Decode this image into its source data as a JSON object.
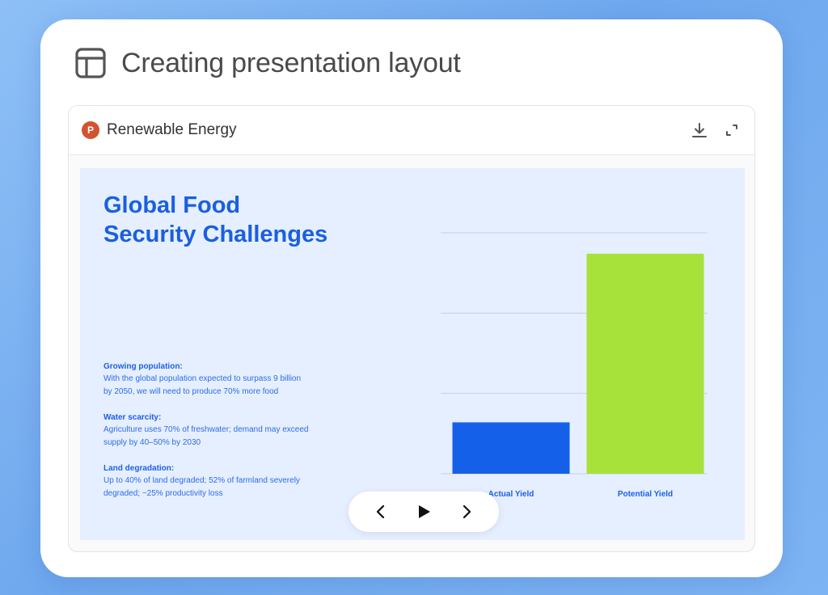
{
  "header": {
    "title": "Creating presentation layout",
    "icon": "layout-grid-icon"
  },
  "viewer": {
    "file_name": "Renewable Energy",
    "file_icon_letter": "P",
    "file_icon": "powerpoint-icon",
    "actions": [
      "download-icon",
      "expand-icon"
    ]
  },
  "slide": {
    "title_line1": "Global Food",
    "title_line2": "Security Challenges",
    "bullets": [
      {
        "heading": "Growing population:",
        "line1": "With the global population expected to surpass 9 billion",
        "line2": "by 2050, we will need to produce 70% more food"
      },
      {
        "heading": "Water scarcity:",
        "line1": "Agriculture uses 70% of freshwater; demand may exceed",
        "line2": "supply by 40–50% by 2030"
      },
      {
        "heading": "Land degradation:",
        "line1": "Up to 40% of land degraded; 52% of farmland severely",
        "line2": "degraded; ~25% productivity loss"
      }
    ]
  },
  "chart_data": {
    "type": "bar",
    "categories": [
      "Actual Yield",
      "Potential Yield"
    ],
    "values": [
      0.32,
      1.37
    ],
    "ylim": [
      0,
      1.5
    ],
    "grid": true,
    "colors": [
      "#1560e8",
      "#a6e23a"
    ]
  },
  "controls": {
    "prev": "chevron-left-icon",
    "play": "play-icon",
    "next": "chevron-right-icon"
  }
}
